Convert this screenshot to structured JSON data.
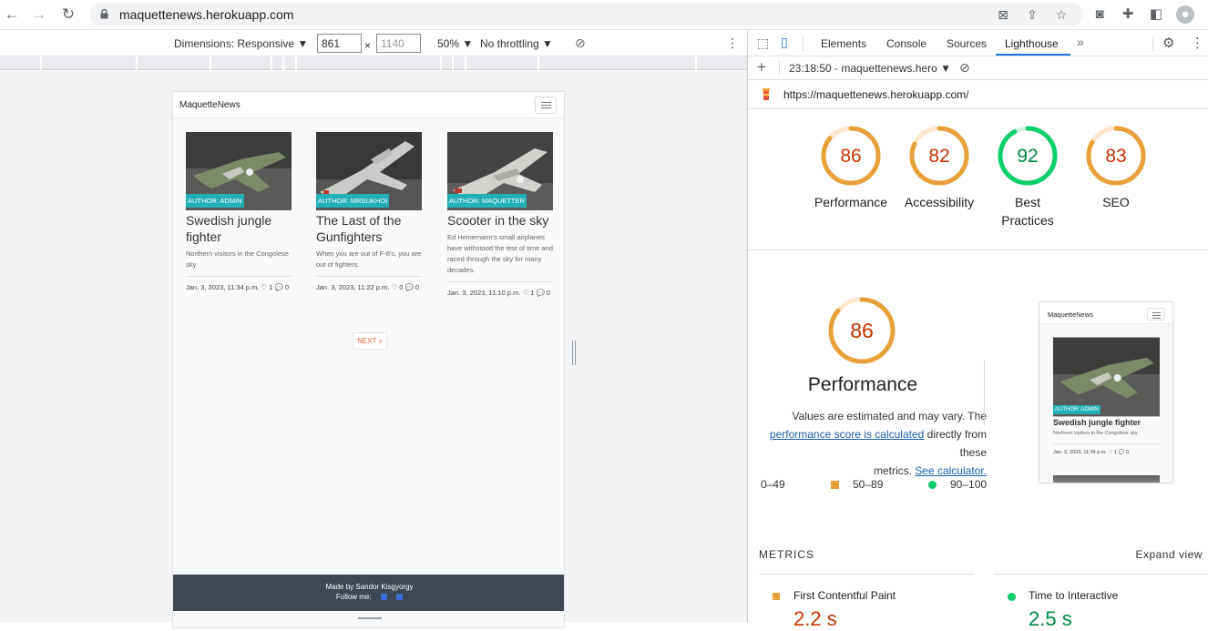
{
  "browser": {
    "url": "maquettenews.herokuapp.com"
  },
  "device_toolbar": {
    "dimensions_label": "Dimensions: Responsive",
    "width": "861",
    "height": "1140",
    "times_sign": "×",
    "zoom": "50%",
    "throttling": "No throttling"
  },
  "site": {
    "brand": "MaquetteNews",
    "posts": [
      {
        "author": "AUTHOR: ADMIN",
        "title": "Swedish jungle fighter",
        "excerpt": "Northern visitors in the Congolese sky",
        "meta": "Jan. 3, 2023, 11:34 p.m. ♡ 1 💬 0"
      },
      {
        "author": "AUTHOR: MRSUKHOI",
        "title": "The Last of the Gunfighters",
        "excerpt": "When you are out of F-8's, you are out of fighters.",
        "meta": "Jan. 3, 2023, 11:22 p.m. ♡ 0 💬 0"
      },
      {
        "author": "AUTHOR: MAQUETTER",
        "title": "Scooter in the sky",
        "excerpt": "Ed Heinemann's small airplanes have withstood the test of time and raced through the sky for many decades.",
        "meta": "Jan. 3, 2023, 11:10 p.m. ♡ 1 💬 0"
      }
    ],
    "next_label": "NEXT »",
    "footer": {
      "made_by": "Made by Sandor Kisgyorgy",
      "follow": "Follow me:"
    }
  },
  "devtools": {
    "tabs": [
      "Elements",
      "Console",
      "Sources",
      "Lighthouse"
    ],
    "more_tabs": "»",
    "active_tab": "Lighthouse",
    "report_label": "23:18:50 - maquettenews.hero",
    "audited_url": "https://maquettenews.herokuapp.com/",
    "scores": [
      {
        "label": "Performance",
        "value": "86",
        "band": "average"
      },
      {
        "label": "Accessibility",
        "value": "82",
        "band": "average"
      },
      {
        "label": "Best Practices",
        "value": "92",
        "band": "pass"
      },
      {
        "label": "SEO",
        "value": "83",
        "band": "average"
      }
    ],
    "performance": {
      "score": "86",
      "title": "Performance",
      "note_1": "Values are estimated and may vary. The",
      "link_1": "performance score is calculated",
      "note_2": "directly from these",
      "note_3": "metrics.",
      "link_2": "See calculator."
    },
    "legend": [
      "0–49",
      "50–89",
      "90–100"
    ],
    "thumbnail": {
      "brand": "MaquetteNews",
      "author": "AUTHOR: ADMIN",
      "title": "Swedish jungle fighter",
      "excerpt": "Northern visitors in the Congolese sky",
      "meta": "Jan. 3, 2023, 11:34 p.m. ♡ 1 💬 0"
    },
    "metrics_heading": "METRICS",
    "expand_view": "Expand view",
    "metrics": [
      {
        "name": "First Contentful Paint",
        "value": "2.2 s",
        "band": "average"
      },
      {
        "name": "Time to Interactive",
        "value": "2.5 s",
        "band": "pass"
      }
    ],
    "colors": {
      "average": "#e8a13a",
      "average_text": "#c33300",
      "pass": "#0cce6b",
      "pass_text": "#018642",
      "link": "#1a5fb4"
    }
  }
}
